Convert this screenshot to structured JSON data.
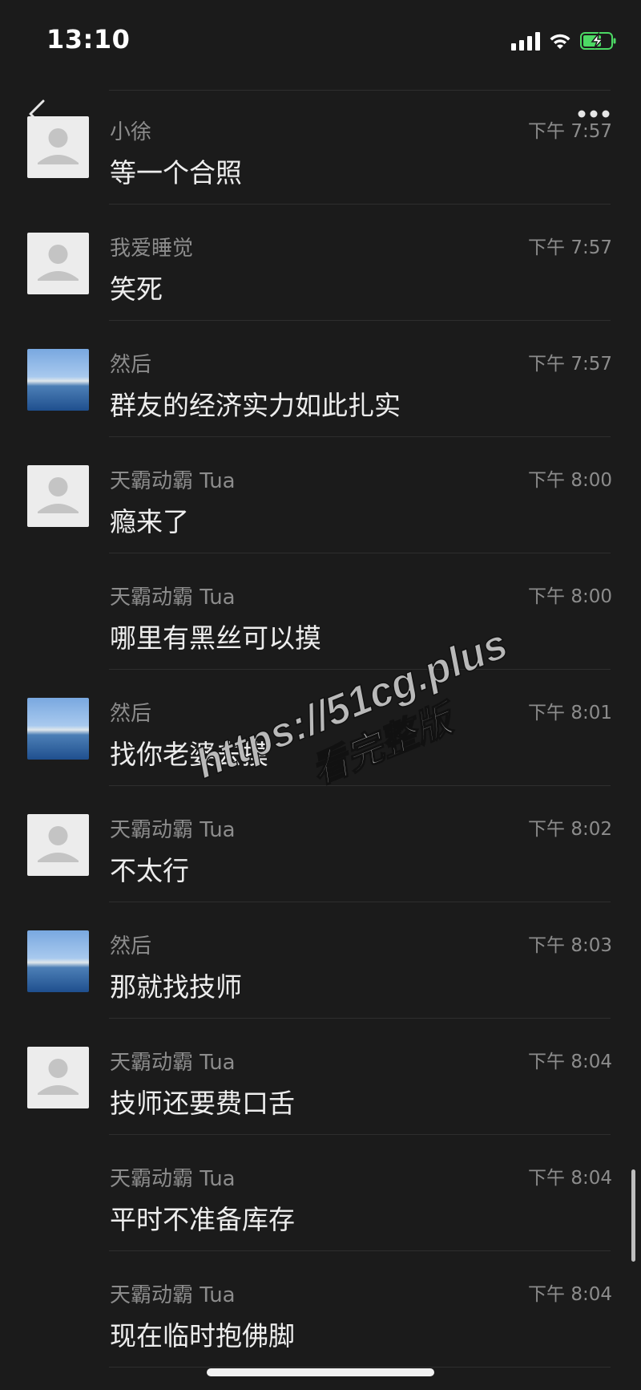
{
  "status": {
    "time": "13:10",
    "icons": [
      "cellular-signal-icon",
      "wifi-icon",
      "battery-charging-icon"
    ],
    "battery_color": "#4cd964"
  },
  "header": {
    "back_icon": "chevron-left-icon",
    "more_icon": "ellipsis-icon"
  },
  "messages": [
    {
      "avatar": "default",
      "sender": "小徐",
      "time": "下午 7:57",
      "text": "等一个合照"
    },
    {
      "avatar": "default",
      "sender": "我爱睡觉",
      "time": "下午 7:57",
      "text": "笑死"
    },
    {
      "avatar": "landscape",
      "sender": "然后",
      "time": "下午 7:57",
      "text": "群友的经济实力如此扎实"
    },
    {
      "avatar": "default",
      "sender": "天霸动霸 Tua",
      "time": "下午 8:00",
      "text": "瘾来了"
    },
    {
      "avatar": "none",
      "sender": "天霸动霸 Tua",
      "time": "下午 8:00",
      "text": "哪里有黑丝可以摸"
    },
    {
      "avatar": "landscape",
      "sender": "然后",
      "time": "下午 8:01",
      "text": "找你老婆去摸"
    },
    {
      "avatar": "default",
      "sender": "天霸动霸 Tua",
      "time": "下午 8:02",
      "text": "不太行"
    },
    {
      "avatar": "landscape",
      "sender": "然后",
      "time": "下午 8:03",
      "text": "那就找技师"
    },
    {
      "avatar": "default",
      "sender": "天霸动霸 Tua",
      "time": "下午 8:04",
      "text": "技师还要费口舌"
    },
    {
      "avatar": "none",
      "sender": "天霸动霸 Tua",
      "time": "下午 8:04",
      "text": "平时不准备库存"
    },
    {
      "avatar": "none",
      "sender": "天霸动霸 Tua",
      "time": "下午 8:04",
      "text": "现在临时抱佛脚"
    }
  ],
  "watermark": {
    "line1": "https://51cg.plus",
    "line2": "看完整版"
  }
}
